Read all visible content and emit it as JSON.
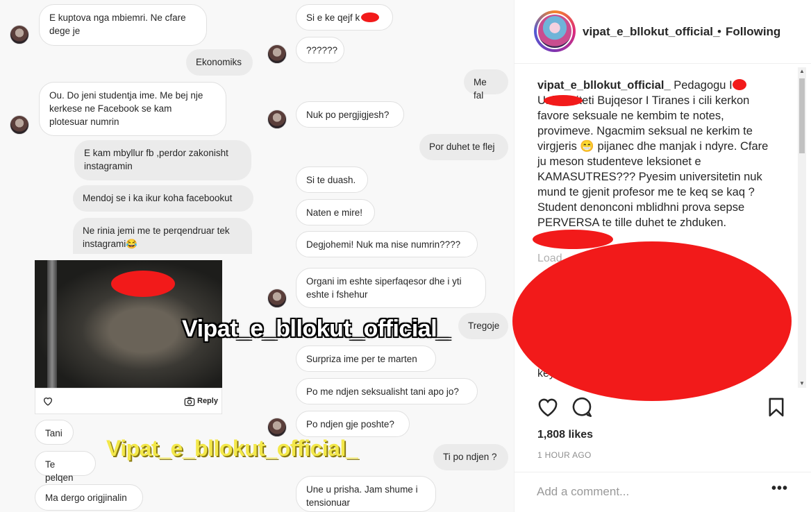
{
  "post": {
    "username": "vipat_e_bllokut_official_",
    "separator": "•",
    "follow_status": "Following",
    "caption_username": "vipat_e_bllokut_official_",
    "caption_text": " Pedagogu I    K      Universiteti Bujqesor I Tiranes i cili kerkon favore seksuale ne kembim te notes, provimeve. Ngacmim seksual ne kerkim te virgjeris 😁 pijanec dhe manjak i ndyre. Cfare ju meson studenteve leksionet e KAMASUTRES??? Pyesim universitetin nuk mund te gjenit profesor me te keq se kaq ? Student denonconi mblidhni prova sepse PERVERSA te tille duhet te zhduken.",
    "load_more": "Load",
    "caption_tail": "key",
    "likes": "1,808 likes",
    "time_ago": "1 HOUR AGO",
    "comment_placeholder": "Add a comment...",
    "more_label": "•••"
  },
  "chat": {
    "left_column": [
      {
        "text": "E kuptova nga mbiemri. Ne cfare\ndege je",
        "side": "in"
      },
      {
        "text": "Ekonomiks",
        "side": "out"
      },
      {
        "text": "Ou. Do jeni studentja ime. Me bej nje\nkerkese ne Facebook se kam\nplotesuar numrin",
        "side": "in"
      },
      {
        "text": "E kam mbyllur fb ,perdor zakonisht\ninstagramin",
        "side": "out"
      },
      {
        "text": "Mendoj se i ka ikur koha facebookut",
        "side": "out"
      },
      {
        "text": "Ne rinia jemi me te perqendruar tek\ninstagrami😂",
        "side": "out"
      },
      {
        "text": "Tani",
        "side": "in"
      },
      {
        "text": "Te pelqen",
        "side": "in"
      },
      {
        "text": "Ma dergo origjinalin",
        "side": "in"
      }
    ],
    "right_column": [
      {
        "text": "Si e ke qejf k   ?",
        "side": "in"
      },
      {
        "text": "??????",
        "side": "in"
      },
      {
        "text": "Me fal",
        "side": "out"
      },
      {
        "text": "Nuk po pergjigjesh?",
        "side": "in"
      },
      {
        "text": "Por duhet te flej",
        "side": "out"
      },
      {
        "text": "Si te duash.",
        "side": "in"
      },
      {
        "text": "Naten e mire!",
        "side": "in"
      },
      {
        "text": "Degjohemi! Nuk ma nise numrin????",
        "side": "in"
      },
      {
        "text": "Organi im eshte siperfaqesor dhe i yti\neshte i fshehur",
        "side": "in"
      },
      {
        "text": "Tregoje",
        "side": "out"
      },
      {
        "text": "Surpriza ime per te marten",
        "side": "in"
      },
      {
        "text": "Po me ndjen seksualisht tani apo jo?",
        "side": "in"
      },
      {
        "text": "Po ndjen gje poshte?",
        "side": "in"
      },
      {
        "text": "Ti po ndjen ?",
        "side": "out"
      },
      {
        "text": "Une u prisha. Jam shume i\ntensionuar",
        "side": "in"
      }
    ],
    "reply_label": "Reply"
  },
  "watermarks": {
    "white": "Vipat_e_bllokut_official_",
    "yellow": "Vipat_e_bllokut_official_"
  },
  "colors": {
    "redaction": "#f21a1a",
    "bubble_in_bg": "#ffffff",
    "bubble_out_bg": "#ebebeb"
  },
  "icons": [
    "heart-icon",
    "comment-icon",
    "bookmark-icon",
    "camera-icon"
  ]
}
